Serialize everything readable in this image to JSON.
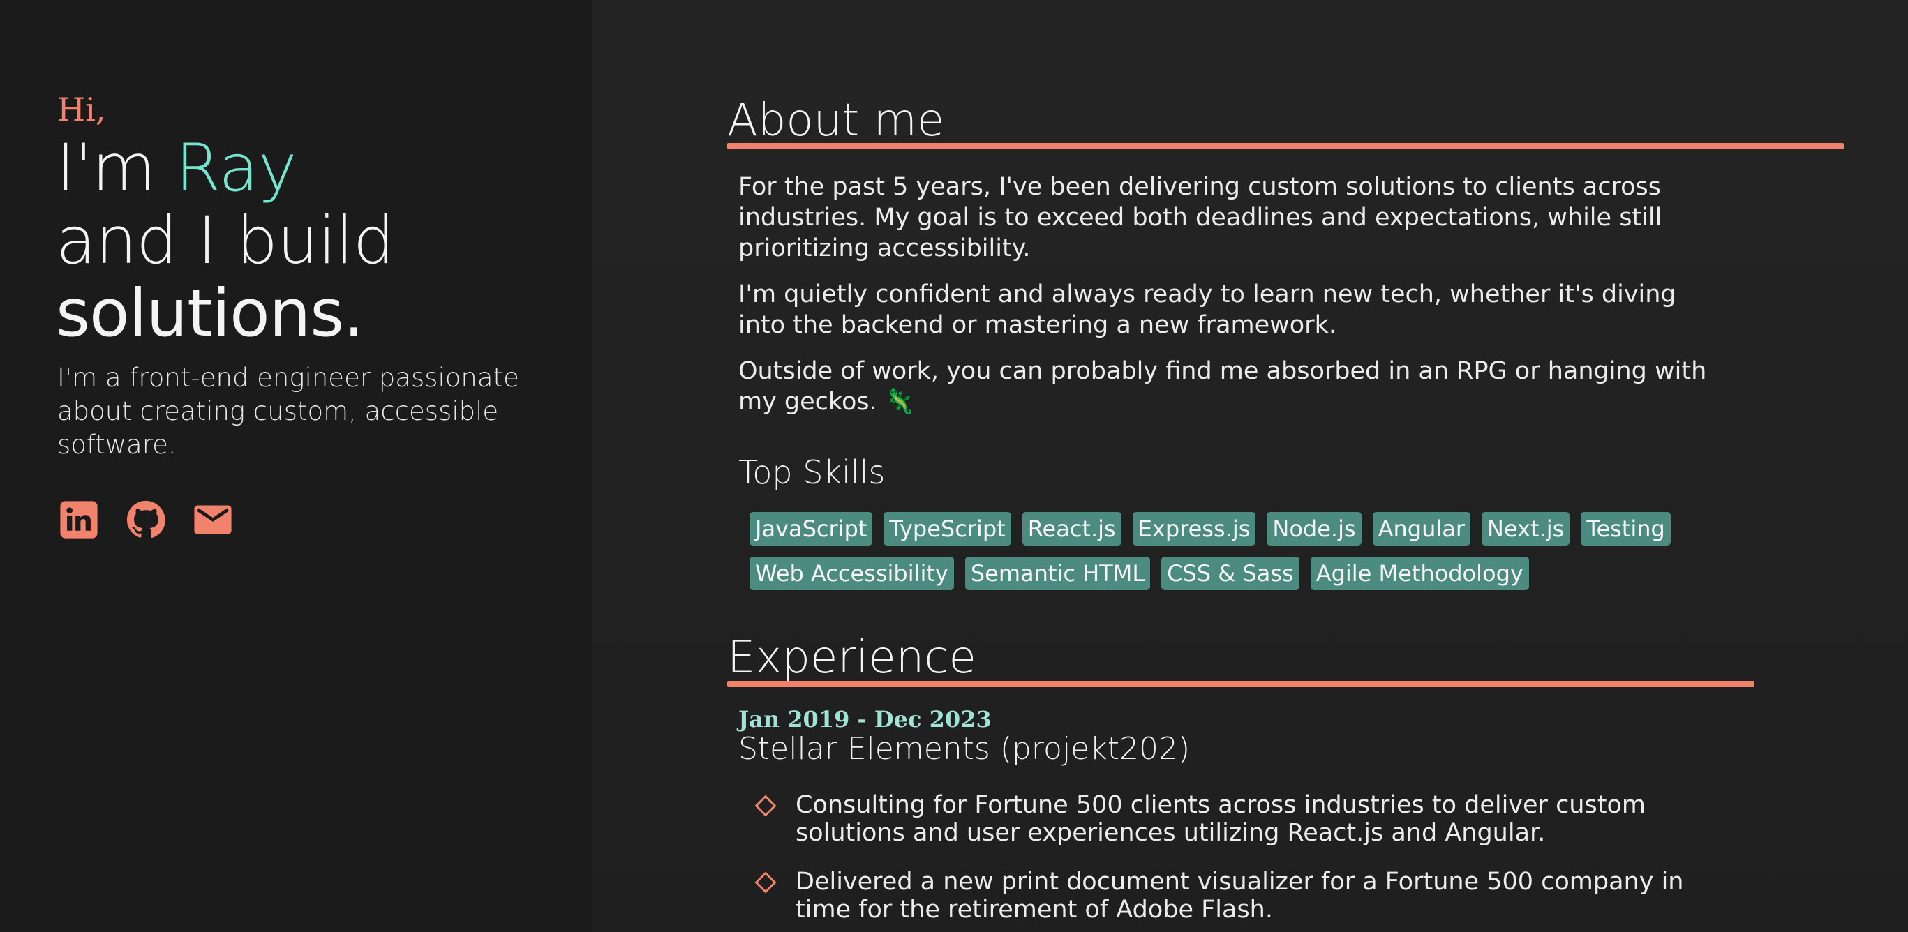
{
  "sidebar": {
    "greeting": "Hi,",
    "intro_prefix": "I'm ",
    "name": "Ray",
    "line2": "and I build",
    "line3": "solutions.",
    "tagline": "I'm a front-end engineer passionate about creating custom, accessible software.",
    "socials": [
      {
        "icon": "linkedin-icon"
      },
      {
        "icon": "github-icon"
      },
      {
        "icon": "mail-icon"
      }
    ]
  },
  "about": {
    "title": "About me",
    "paragraphs": [
      "For the past 5 years, I've been delivering custom solutions to clients across industries. My goal is to exceed both deadlines and expectations, while still prioritizing accessibility.",
      "I'm quietly confident and always ready to learn new tech, whether it's diving into the backend or mastering a new framework.",
      "Outside of work, you can probably find me absorbed in an RPG or hanging with my geckos. 🦎"
    ],
    "skills_title": "Top Skills",
    "skills": [
      "JavaScript",
      "TypeScript",
      "React.js",
      "Express.js",
      "Node.js",
      "Angular",
      "Next.js",
      "Testing",
      "Web Accessibility",
      "Semantic HTML",
      "CSS & Sass",
      "Agile Methodology"
    ]
  },
  "experience": {
    "title": "Experience",
    "jobs": [
      {
        "dates": "Jan 2019 - Dec 2023",
        "company": "Stellar Elements (projekt202)",
        "bullets": [
          "Consulting for Fortune 500 clients across industries to deliver custom solutions and user experiences utilizing React.js and Angular.",
          "Delivered a new print document visualizer for a Fortune 500 company in time for the retirement of Adobe Flash."
        ]
      }
    ]
  },
  "colors": {
    "accent_coral": "#f1826c",
    "accent_teal": "#74e6cf",
    "skill_tag_bg": "#4c8c80",
    "background": "#1c1c1c"
  }
}
